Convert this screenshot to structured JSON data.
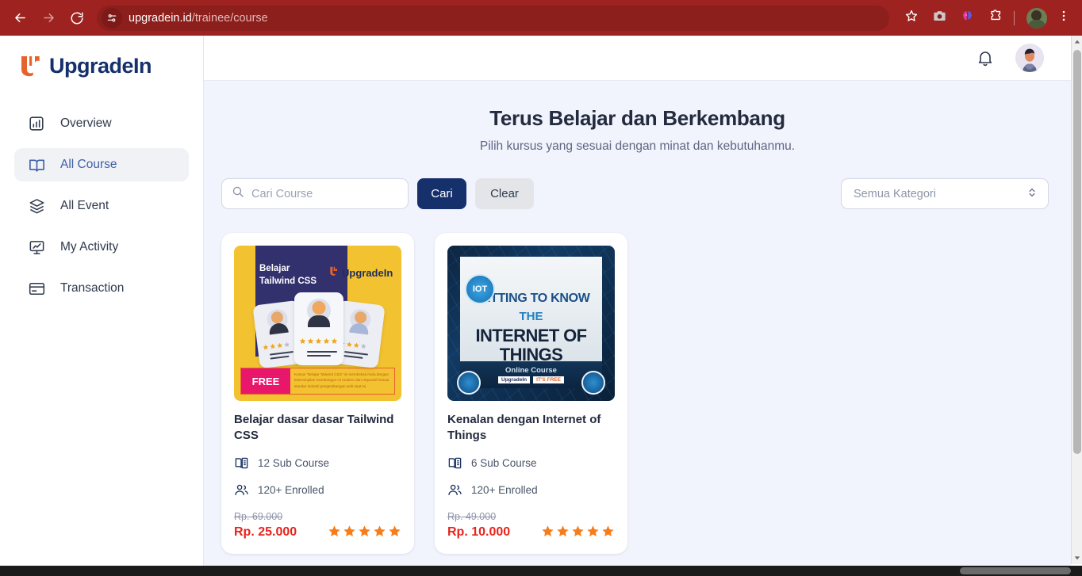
{
  "browser": {
    "url_domain": "upgradein.id",
    "url_path": "/trainee/course",
    "back_icon": "back-arrow-icon",
    "forward_icon": "forward-arrow-icon",
    "reload_icon": "reload-icon",
    "site_info_icon": "site-settings-icon",
    "bookmark_icon": "star-icon",
    "toolbar_icons": [
      "camera-icon",
      "ai-brain-icon",
      "extensions-puzzle-icon"
    ],
    "profile_icon": "chrome-profile-avatar",
    "menu_icon": "three-dot-menu-icon",
    "chrome_bg": "#9e2320"
  },
  "sidebar": {
    "logo_text": "UpgradeIn",
    "logo_accent": "#e8632c",
    "logo_navy": "#16306b",
    "items": [
      {
        "label": "Overview",
        "icon": "chart-bar-icon",
        "active": false
      },
      {
        "label": "All Course",
        "icon": "book-open-icon",
        "active": true
      },
      {
        "label": "All Event",
        "icon": "layers-icon",
        "active": false
      },
      {
        "label": "My Activity",
        "icon": "presentation-chart-icon",
        "active": false
      },
      {
        "label": "Transaction",
        "icon": "credit-card-icon",
        "active": false
      }
    ]
  },
  "topbar": {
    "bell_icon": "notification-bell-icon",
    "avatar_icon": "user-avatar"
  },
  "page": {
    "title": "Terus Belajar dan Berkembang",
    "subtitle": "Pilih kursus yang sesuai dengan minat dan kebutuhanmu."
  },
  "filters": {
    "search_placeholder": "Cari Course",
    "search_value": "",
    "search_icon": "search-icon",
    "search_button": "Cari",
    "clear_button": "Clear",
    "category_selected": "Semua Kategori",
    "category_chevron_icon": "chevron-up-down-icon"
  },
  "courses": [
    {
      "title": "Belajar dasar dasar Tailwind CSS",
      "sub_course": "12 Sub Course",
      "enrolled": "120+ Enrolled",
      "price_old": "Rp. 69.000",
      "price_new": "Rp. 25.000",
      "rating": 5,
      "thumb": {
        "heading": "Belajar\nTailwind CSS",
        "brand": "UpgradeIn",
        "badge": "FREE",
        "blurb": "Kursus \"Belajar Tailwind CSS\" ini membekali Anda dengan keterampilan membangun UI modern dan responsif sesuai standar industri pengembangan web saat ini.",
        "bg_color": "#f2c230",
        "panel_color": "#33306e",
        "badge_color": "#e8176c"
      }
    },
    {
      "title": "Kenalan dengan Internet of Things",
      "sub_course": "6 Sub Course",
      "enrolled": "120+ Enrolled",
      "price_old": "Rp. 49.000",
      "price_new": "Rp. 10.000",
      "rating": 5,
      "thumb": {
        "badge": "IOT",
        "line1": "GETTING TO KNOW",
        "line2": "THE",
        "line3": "INTERNET OF THINGS",
        "footer": "Online Course",
        "brand": "UpgradeIn",
        "free_tag": "IT'S FREE",
        "bg_color": "#0d2540"
      }
    }
  ],
  "labels": {
    "book_icon": "book-icon",
    "people_icon": "people-icon",
    "star_icon": "star-filled-icon",
    "star_color": "#f77d1a"
  },
  "scrollbar": {
    "vertical_up_icon": "scroll-up-arrow-icon",
    "vertical_down_icon": "scroll-down-arrow-icon"
  }
}
